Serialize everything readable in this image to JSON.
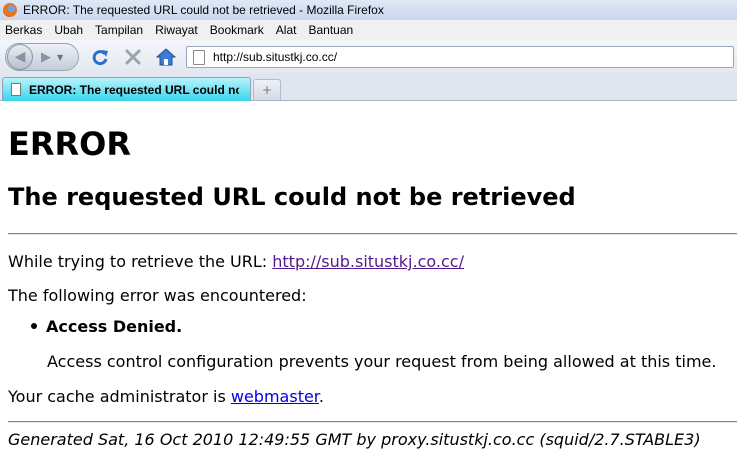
{
  "window": {
    "title": "ERROR: The requested URL could not be retrieved - Mozilla Firefox"
  },
  "menu": [
    {
      "label": "Berkas"
    },
    {
      "label": "Ubah"
    },
    {
      "label": "Tampilan"
    },
    {
      "label": "Riwayat"
    },
    {
      "label": "Bookmark"
    },
    {
      "label": "Alat"
    },
    {
      "label": "Bantuan"
    }
  ],
  "navbar": {
    "url": "http://sub.situstkj.co.cc/"
  },
  "tabs": {
    "active_label": "ERROR: The requested URL could not...",
    "new_tab_symbol": "+"
  },
  "page": {
    "h1": "ERROR",
    "h2": "The requested URL could not be retrieved",
    "url_intro": "While trying to retrieve the URL: ",
    "url_link": "http://sub.situstkj.co.cc/",
    "error_intro": "The following error was encountered:",
    "error_title": "Access Denied.",
    "error_detail": "Access control configuration prevents your request from being allowed at this time.",
    "admin_text": "Your cache administrator is ",
    "admin_link": "webmaster",
    "admin_end": ".",
    "footer": "Generated Sat, 16 Oct 2010 12:49:55 GMT by proxy.situstkj.co.cc (squid/2.7.STABLE3)"
  },
  "colors": {
    "visited_link": "#551a8b",
    "link": "#0000ee",
    "active_tab": "#38d6ec"
  }
}
